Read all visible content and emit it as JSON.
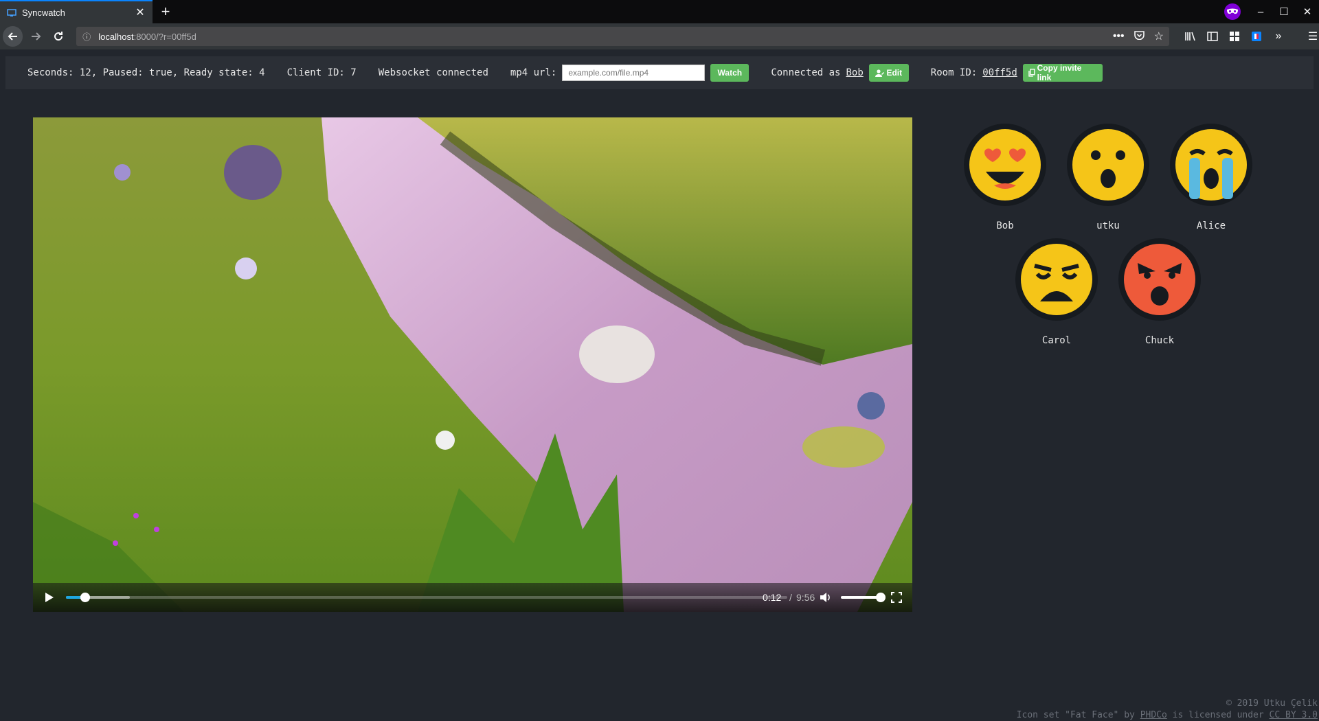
{
  "browser": {
    "tab_title": "Syncwatch",
    "url_host": "localhost",
    "url_rest": ":8000/?r=00ff5d"
  },
  "status": {
    "state_text": "Seconds: 12, Paused: true, Ready state: 4",
    "client_id_text": "Client ID: 7",
    "websocket_text": "Websocket connected",
    "mp4_label": "mp4 url:",
    "mp4_placeholder": "example.com/file.mp4",
    "watch_label": "Watch",
    "connected_as_label": "Connected as",
    "username": "Bob",
    "edit_label": "Edit",
    "room_id_label": "Room ID:",
    "room_id": "00ff5d",
    "copy_invite_label": "Copy invite link"
  },
  "player": {
    "current_time": "0:12",
    "separator": "/",
    "duration": "9:56",
    "progress_fraction": 0.02,
    "volume_fraction": 0.85,
    "paused": true
  },
  "users": [
    {
      "name": "Bob",
      "face": "heart-eyes-face-icon",
      "color": "#f5c518"
    },
    {
      "name": "utku",
      "face": "surprised-face-icon",
      "color": "#f5c518"
    },
    {
      "name": "Alice",
      "face": "crying-face-icon",
      "color": "#f5c518"
    },
    {
      "name": "Carol",
      "face": "sad-face-icon",
      "color": "#f5c518"
    },
    {
      "name": "Chuck",
      "face": "angry-face-icon",
      "color": "#ee5a3a"
    }
  ],
  "footer": {
    "copyright": "© 2019 Utku Çelik",
    "credit_prefix": "Icon set \"Fat Face\" by",
    "credit_author": "PHDCo",
    "credit_mid": "is licensed under",
    "credit_license": "CC BY 3.0"
  },
  "colors": {
    "accent_green": "#5cb85c",
    "page_bg": "#22262d",
    "seek_played": "#1ea7e1"
  }
}
